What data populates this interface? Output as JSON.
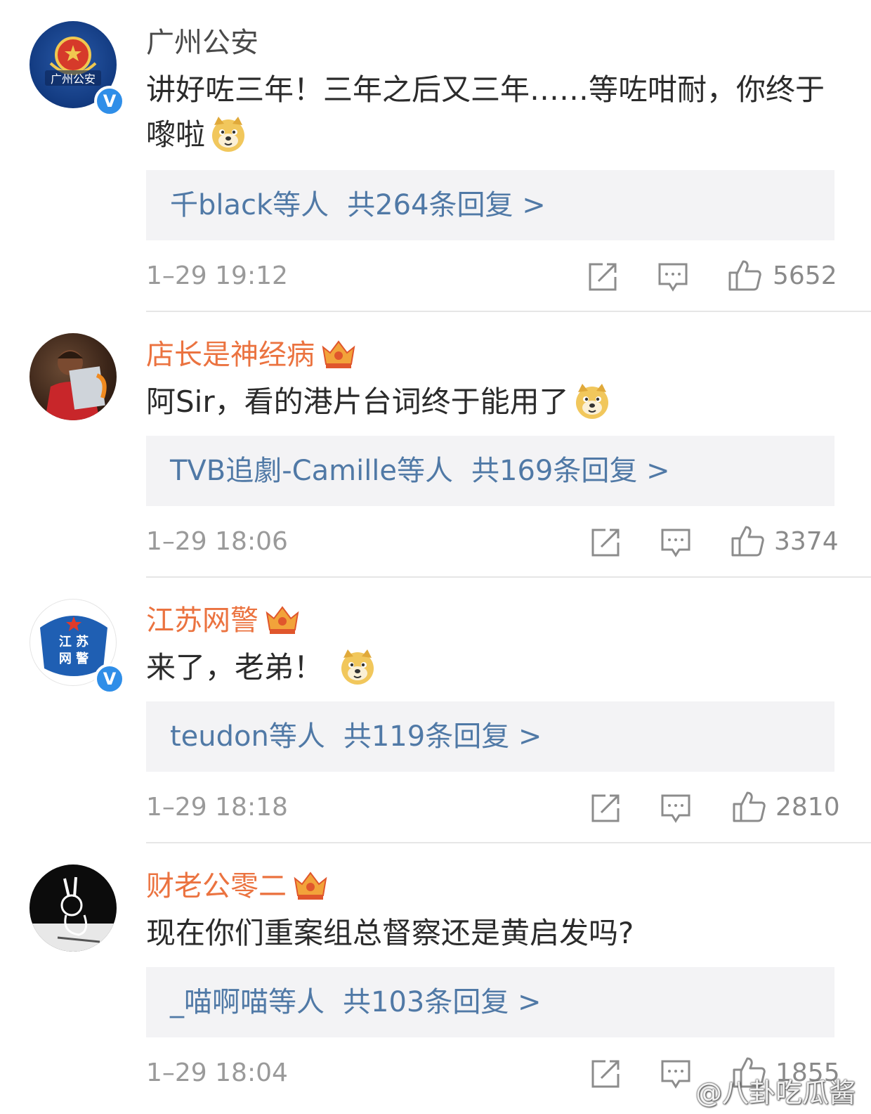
{
  "comments": [
    {
      "username": "广州公安",
      "verified": true,
      "vip": false,
      "text": "讲好咗三年！三年之后又三年……等咗咁耐，你终于嚟啦",
      "emoji": "doge-emoji",
      "reply_users": "千black等人",
      "reply_count": "共264条回复 >",
      "time": "1–29 19:12",
      "likes": "5652",
      "avatar_text": "广州公安"
    },
    {
      "username": "店长是神经病",
      "verified": false,
      "vip": true,
      "text": "阿Sir，看的港片台词终于能用了",
      "emoji": "doge-emoji",
      "reply_users": "TVB追劇-Camille等人",
      "reply_count": "共169条回复 >",
      "time": "1–29 18:06",
      "likes": "3374",
      "avatar_text": ""
    },
    {
      "username": "江苏网警",
      "verified": true,
      "vip": true,
      "text": "来了，老弟！",
      "emoji": "doge-emoji",
      "reply_users": "teudon等人",
      "reply_count": "共119条回复 >",
      "time": "1–29 18:18",
      "likes": "2810",
      "avatar_text": "江苏网警"
    },
    {
      "username": "财老公零二",
      "verified": false,
      "vip": true,
      "text": "现在你们重案组总督察还是黄启发吗?",
      "emoji": "",
      "reply_users": "_喵啊喵等人",
      "reply_count": "共103条回复 >",
      "time": "1–29 18:04",
      "likes": "1855",
      "avatar_text": ""
    }
  ],
  "watermark": "@八卦吃瓜酱",
  "icons": {
    "share": "share-icon",
    "comment": "comment-icon",
    "like": "like-icon",
    "verified": "verified-badge-icon",
    "vip": "crown-vip-icon"
  },
  "colors": {
    "vip_name": "#eb7340",
    "plain_name": "#4a4a4a",
    "reply_link": "#5079a6",
    "reply_bg": "#f3f3f5",
    "verified": "#2f8ee8"
  }
}
